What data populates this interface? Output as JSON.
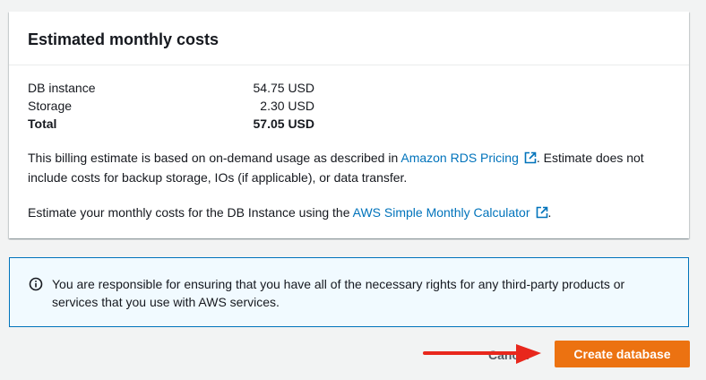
{
  "card": {
    "title": "Estimated monthly costs",
    "costs": [
      {
        "label": "DB instance",
        "value": "54.75 USD"
      },
      {
        "label": "Storage",
        "value": "2.30 USD"
      },
      {
        "label": "Total",
        "value": "57.05 USD"
      }
    ],
    "billing_text_before": "This billing estimate is based on on-demand usage as described in ",
    "billing_link": "Amazon RDS Pricing",
    "billing_text_after": ". Estimate does not include costs for backup storage, IOs (if applicable), or data transfer.",
    "calc_text_before": "Estimate your monthly costs for the DB Instance using the ",
    "calc_link": "AWS Simple Monthly Calculator",
    "calc_text_after": "."
  },
  "alert": {
    "icon": "info-icon",
    "text": "You are responsible for ensuring that you have all of the necessary rights for any third-party products or services that you use with AWS services."
  },
  "actions": {
    "cancel_label": "Cancel",
    "create_label": "Create database"
  },
  "colors": {
    "primary_button": "#ec7211",
    "link": "#0073bb",
    "annotation_arrow": "#e8271c"
  }
}
